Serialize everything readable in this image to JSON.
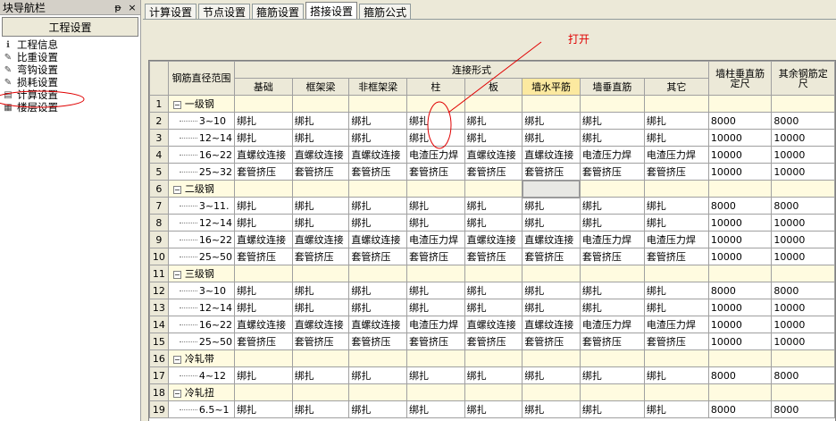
{
  "nav": {
    "title": "块导航栏",
    "pin_label": "ᵽ",
    "close_label": "×",
    "header": "工程设置",
    "items": [
      {
        "label": "工程信息",
        "icon": "info-icon"
      },
      {
        "label": "比重设置",
        "icon": "pencil-icon"
      },
      {
        "label": "弯钩设置",
        "icon": "pencil-icon"
      },
      {
        "label": "损耗设置",
        "icon": "pencil-icon"
      },
      {
        "label": "计算设置",
        "icon": "calculator-icon"
      },
      {
        "label": "楼层设置",
        "icon": "floors-icon"
      }
    ]
  },
  "tabs": [
    {
      "label": "计算设置",
      "active": false
    },
    {
      "label": "节点设置",
      "active": false
    },
    {
      "label": "箍筋设置",
      "active": false
    },
    {
      "label": "搭接设置",
      "active": true
    },
    {
      "label": "箍筋公式",
      "active": false
    }
  ],
  "annotation": {
    "text": "打开",
    "color": "#e00000"
  },
  "grid": {
    "header_range": "钢筋直径范围",
    "header_group": "连接形式",
    "header_wall_col": "墙柱垂直筋定尺",
    "header_other": "其余钢筋定尺",
    "columns": [
      "基础",
      "框架梁",
      "非框架梁",
      "柱",
      "板",
      "墙水平筋",
      "墙垂直筋",
      "其它"
    ],
    "highlight_column": "墙水平筋",
    "rows": [
      {
        "num": "1",
        "group": true,
        "label": "一级钢"
      },
      {
        "num": "2",
        "label": "3~10",
        "cells": [
          "绑扎",
          "绑扎",
          "绑扎",
          "绑扎",
          "绑扎",
          "绑扎",
          "绑扎",
          "绑扎"
        ],
        "wall": "8000",
        "other": "8000"
      },
      {
        "num": "3",
        "label": "12~14",
        "cells": [
          "绑扎",
          "绑扎",
          "绑扎",
          "绑扎",
          "绑扎",
          "绑扎",
          "绑扎",
          "绑扎"
        ],
        "wall": "10000",
        "other": "10000"
      },
      {
        "num": "4",
        "label": "16~22",
        "cells": [
          "直螺纹连接",
          "直螺纹连接",
          "直螺纹连接",
          "电渣压力焊",
          "直螺纹连接",
          "直螺纹连接",
          "电渣压力焊",
          "电渣压力焊"
        ],
        "wall": "10000",
        "other": "10000"
      },
      {
        "num": "5",
        "label": "25~32",
        "cells": [
          "套管挤压",
          "套管挤压",
          "套管挤压",
          "套管挤压",
          "套管挤压",
          "套管挤压",
          "套管挤压",
          "套管挤压"
        ],
        "wall": "10000",
        "other": "10000"
      },
      {
        "num": "6",
        "group": true,
        "label": "二级钢"
      },
      {
        "num": "7",
        "label": "3~11.",
        "cells": [
          "绑扎",
          "绑扎",
          "绑扎",
          "绑扎",
          "绑扎",
          "绑扎",
          "绑扎",
          "绑扎"
        ],
        "wall": "8000",
        "other": "8000"
      },
      {
        "num": "8",
        "label": "12~14",
        "cells": [
          "绑扎",
          "绑扎",
          "绑扎",
          "绑扎",
          "绑扎",
          "绑扎",
          "绑扎",
          "绑扎"
        ],
        "wall": "10000",
        "other": "10000"
      },
      {
        "num": "9",
        "label": "16~22",
        "cells": [
          "直螺纹连接",
          "直螺纹连接",
          "直螺纹连接",
          "电渣压力焊",
          "直螺纹连接",
          "直螺纹连接",
          "电渣压力焊",
          "电渣压力焊"
        ],
        "wall": "10000",
        "other": "10000"
      },
      {
        "num": "10",
        "label": "25~50",
        "cells": [
          "套管挤压",
          "套管挤压",
          "套管挤压",
          "套管挤压",
          "套管挤压",
          "套管挤压",
          "套管挤压",
          "套管挤压"
        ],
        "wall": "10000",
        "other": "10000"
      },
      {
        "num": "11",
        "group": true,
        "label": "三级钢"
      },
      {
        "num": "12",
        "label": "3~10",
        "cells": [
          "绑扎",
          "绑扎",
          "绑扎",
          "绑扎",
          "绑扎",
          "绑扎",
          "绑扎",
          "绑扎"
        ],
        "wall": "8000",
        "other": "8000"
      },
      {
        "num": "13",
        "label": "12~14",
        "cells": [
          "绑扎",
          "绑扎",
          "绑扎",
          "绑扎",
          "绑扎",
          "绑扎",
          "绑扎",
          "绑扎"
        ],
        "wall": "10000",
        "other": "10000"
      },
      {
        "num": "14",
        "label": "16~22",
        "cells": [
          "直螺纹连接",
          "直螺纹连接",
          "直螺纹连接",
          "电渣压力焊",
          "直螺纹连接",
          "直螺纹连接",
          "电渣压力焊",
          "电渣压力焊"
        ],
        "wall": "10000",
        "other": "10000"
      },
      {
        "num": "15",
        "label": "25~50",
        "cells": [
          "套管挤压",
          "套管挤压",
          "套管挤压",
          "套管挤压",
          "套管挤压",
          "套管挤压",
          "套管挤压",
          "套管挤压"
        ],
        "wall": "10000",
        "other": "10000"
      },
      {
        "num": "16",
        "group": true,
        "label": "冷轧带"
      },
      {
        "num": "17",
        "label": "4~12",
        "cells": [
          "绑扎",
          "绑扎",
          "绑扎",
          "绑扎",
          "绑扎",
          "绑扎",
          "绑扎",
          "绑扎"
        ],
        "wall": "8000",
        "other": "8000"
      },
      {
        "num": "18",
        "group": true,
        "label": "冷轧扭"
      },
      {
        "num": "19",
        "label": "6.5~1",
        "cells": [
          "绑扎",
          "绑扎",
          "绑扎",
          "绑扎",
          "绑扎",
          "绑扎",
          "绑扎",
          "绑扎"
        ],
        "wall": "8000",
        "other": "8000"
      }
    ]
  }
}
